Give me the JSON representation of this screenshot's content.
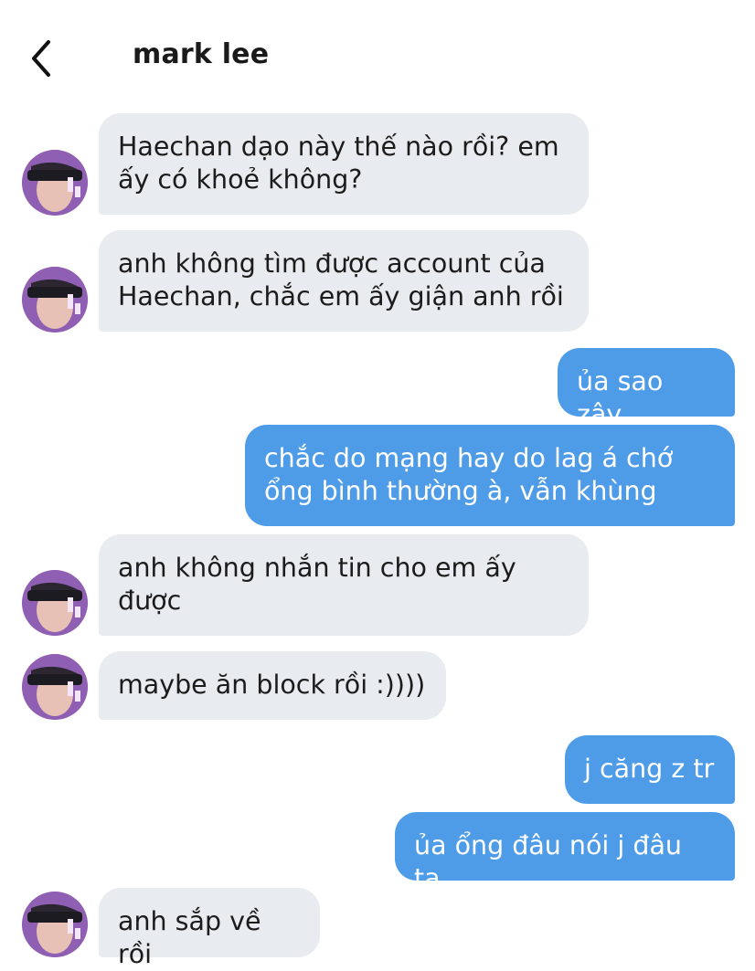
{
  "header": {
    "contact_name": "mark lee",
    "back_icon": "chevron-left-icon"
  },
  "colors": {
    "incoming_bubble": "#e8ebef",
    "outgoing_bubble": "#4e9ce8",
    "outgoing_text": "#ffffff"
  },
  "messages": [
    {
      "from": "them",
      "text": "Haechan dạo này thế nào rồi? em ấy có khoẻ không?"
    },
    {
      "from": "them",
      "text": "anh không tìm được account của Haechan, chắc em ấy giận anh rồi"
    },
    {
      "from": "me",
      "text": "ủa sao zậy"
    },
    {
      "from": "me",
      "text": "chắc do mạng hay do lag á chớ ổng bình thường à, vẫn khùng"
    },
    {
      "from": "them",
      "text": "anh không nhắn tin cho em ấy được"
    },
    {
      "from": "them",
      "text": "maybe ăn block rồi :))))"
    },
    {
      "from": "me",
      "text": "j căng z tr"
    },
    {
      "from": "me",
      "text": "ủa ổng đâu nói j đâu ta"
    },
    {
      "from": "them",
      "text": "anh sắp về rồi"
    }
  ]
}
